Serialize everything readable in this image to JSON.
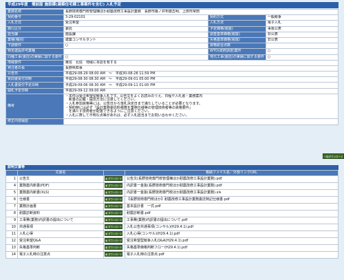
{
  "page_title": "平成29年度　備前版 施設課(建築住宅課工事案件を含む) 入札予定",
  "info_rows": [
    {
      "label": "業務名称",
      "value": "長野技術専門校管理棟ほか耐震改修工事設計業務　長野市篠ノ井布施五明、上田市常田",
      "label2": "",
      "value2": ""
    },
    {
      "label": "契約番号",
      "value": "3-29-02101",
      "label2": "契約方式",
      "value2": "一般競争"
    },
    {
      "label": "入札方式",
      "value": "受注希望",
      "label2": "入札方法",
      "value2": "電子入札"
    },
    {
      "label": "施行区分",
      "value": "委託",
      "label2": "予定価格(税抜)",
      "value2": "事後公表"
    },
    {
      "label": "担当課",
      "value": "施設課",
      "label2": "調査基準価格(税抜)",
      "value2": "非公表"
    },
    {
      "label": "業種(種別)",
      "value": "建築コンサルタント",
      "label2": "失格基準価格(税抜)",
      "value2": "非公表"
    },
    {
      "label": "下請要件",
      "value": "○",
      "label2": "資格総合点数",
      "value2": ""
    },
    {
      "label": "特定建設許可業種",
      "value": "",
      "label2": "WTO(政府調達)案件",
      "value2": "○"
    },
    {
      "label": "同種工事(委託)の実績に関する要件",
      "value": "○",
      "label2": "地元工事(委託)の実績に関する要件",
      "value2": "○"
    },
    {
      "label": "地域要件",
      "value": "東信　北信　地域に本店を有する",
      "label2": "",
      "value2": ""
    },
    {
      "label": "発注者の長",
      "value": "長野県知事",
      "label2": "",
      "value2": ""
    },
    {
      "label": "公告日",
      "value": "平成29-08-29 08:00 AM　〜　平成30-08-28 11:59 PM",
      "label2": "",
      "value2": ""
    },
    {
      "label": "質問書受付日時",
      "value": "平成29-08-30 08:30 AM　〜　平成29-09-01 05:00 PM",
      "label2": "",
      "value2": ""
    },
    {
      "label": "入札書受付予定日時",
      "value": "平成29-09-06 08:30 AM　〜　平成29-09-11 01:00 PM",
      "label2": "",
      "value2": ""
    },
    {
      "label": "開札予定日時",
      "value": "平成29-09-12 09:00 AM",
      "label2": "",
      "value2": ""
    }
  ],
  "remarks_label": "備考",
  "remarks_lines": [
    "・本件は受注希望型競争入札です。公告文をよくお読みのうえ、日程や入札書・業務案内",
    "　新書の記載・提出方法に注意してください。",
    "・入札参加資格等には、公告日から落札決定日まで満たしていることが必要となります。",
    "・契約時には必ず「設計業務委託料積算を業務仕様等の管理技術者等の資格要件」",
    "　を満たす技術者が配置できるようにご注意ください。",
    "・入札に際して不明な点等があれば、必ず入札担当までお問い合わせください。"
  ],
  "correction_label": "修正内容履歴",
  "correction_value": "",
  "download_all_label": "一括ダウンロード",
  "docs_section_title": "説明文書等",
  "docs_headers": {
    "col1": "文書名",
    "col2": "格納ファイル名／外部リンクURL"
  },
  "download_label": "ダウンロード",
  "docs": [
    {
      "num": "1",
      "name": "公告文",
      "file": "公告文(長野技術専門校管理棟ほか耐震改修工事設計業務).pdf"
    },
    {
      "num": "4",
      "name": "業務案内新書(PDF)",
      "file": "内訳書一金抜(長野技術専門校ほか耐震改修工事設計業務).pdf"
    },
    {
      "num": "5",
      "name": "業務案内新書(XLS)",
      "file": "内訳書一金抜(長野技術専門校ほか耐震改修工事設計業務).xls"
    },
    {
      "num": "6",
      "name": "仕様書",
      "file": "【長野技術専門校ほか】耐震改修工事設計業務委託特記仕様書.pdf"
    },
    {
      "num": "7",
      "name": "業務計画書",
      "file": "基本設計書　一式.pdf"
    },
    {
      "num": "8",
      "name": "耐震診断資料",
      "file": "耐震診断書.pdf"
    },
    {
      "num": "9",
      "name": "工事費(業務)内訳書の提出について",
      "file": "工事費(業務)内訳書の提出について.pdf"
    },
    {
      "num": "10",
      "name": "共通事項",
      "file": "入札公告共通事項(コンサル)(H29.4.1).pdf"
    },
    {
      "num": "11",
      "name": "入札心得",
      "file": "入札心得(コンサル)(H29.4.1).pdf"
    },
    {
      "num": "12",
      "name": "受注希望Q&A",
      "file": "受注希望型競争入札Q&A(H29.4.1).pdf"
    },
    {
      "num": "13",
      "name": "失格基準判断",
      "file": "失格基準価格判断フロー(H29.4.1).pdf"
    },
    {
      "num": "14",
      "name": "電子入札時の注意点",
      "file": "電子入札時の注意点.pdf"
    }
  ]
}
